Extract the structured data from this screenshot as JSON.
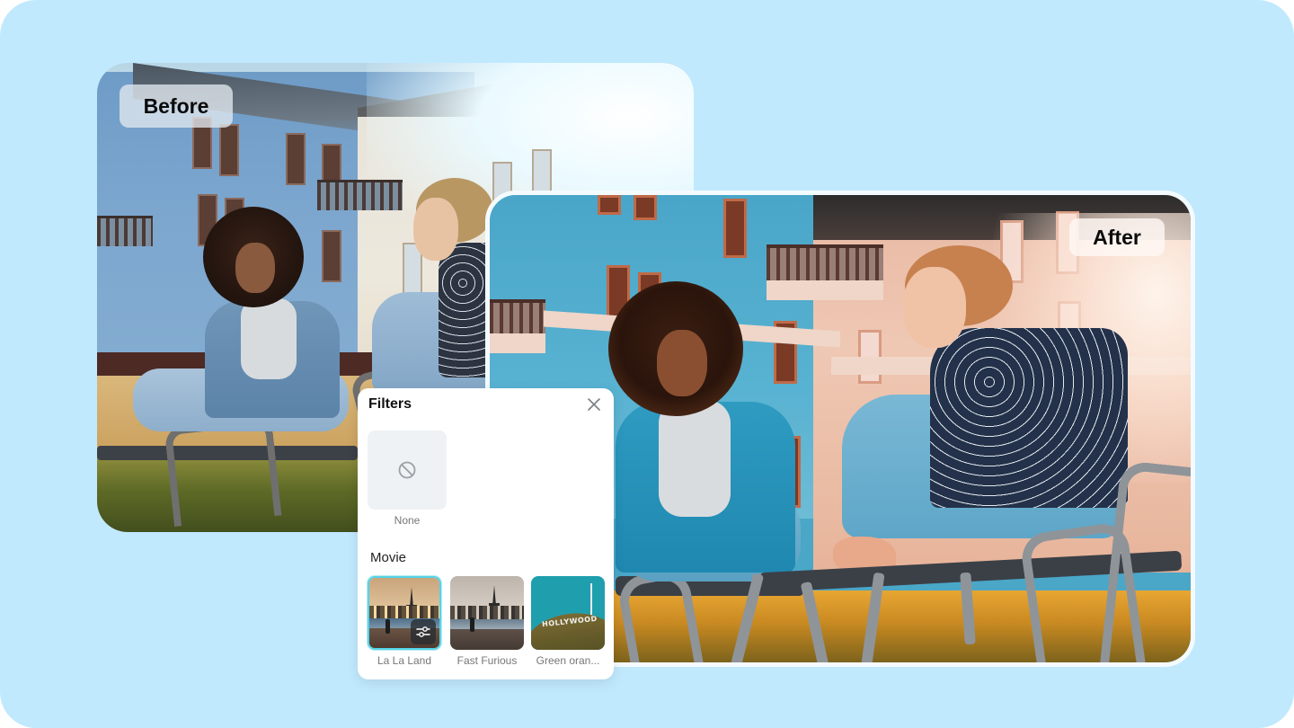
{
  "labels": {
    "before": "Before",
    "after": "After"
  },
  "filters_panel": {
    "title": "Filters",
    "close_icon": "close-icon",
    "none_option": {
      "label": "None",
      "icon": "prohibited-icon"
    },
    "sections": [
      {
        "title": "Movie",
        "items": [
          {
            "label": "La La Land",
            "selected": true,
            "adjust_icon": "sliders-icon"
          },
          {
            "label": "Fast Furious",
            "selected": false
          },
          {
            "label": "Green oran...",
            "selected": false
          }
        ]
      }
    ]
  },
  "thumbnail_text": {
    "hollywood_sign": "HOLLYWOOD"
  },
  "colors": {
    "background": "#c1e9fe",
    "selected_border": "#55d3e6",
    "panel_background": "#ffffff",
    "none_tile": "#eff2f5"
  }
}
